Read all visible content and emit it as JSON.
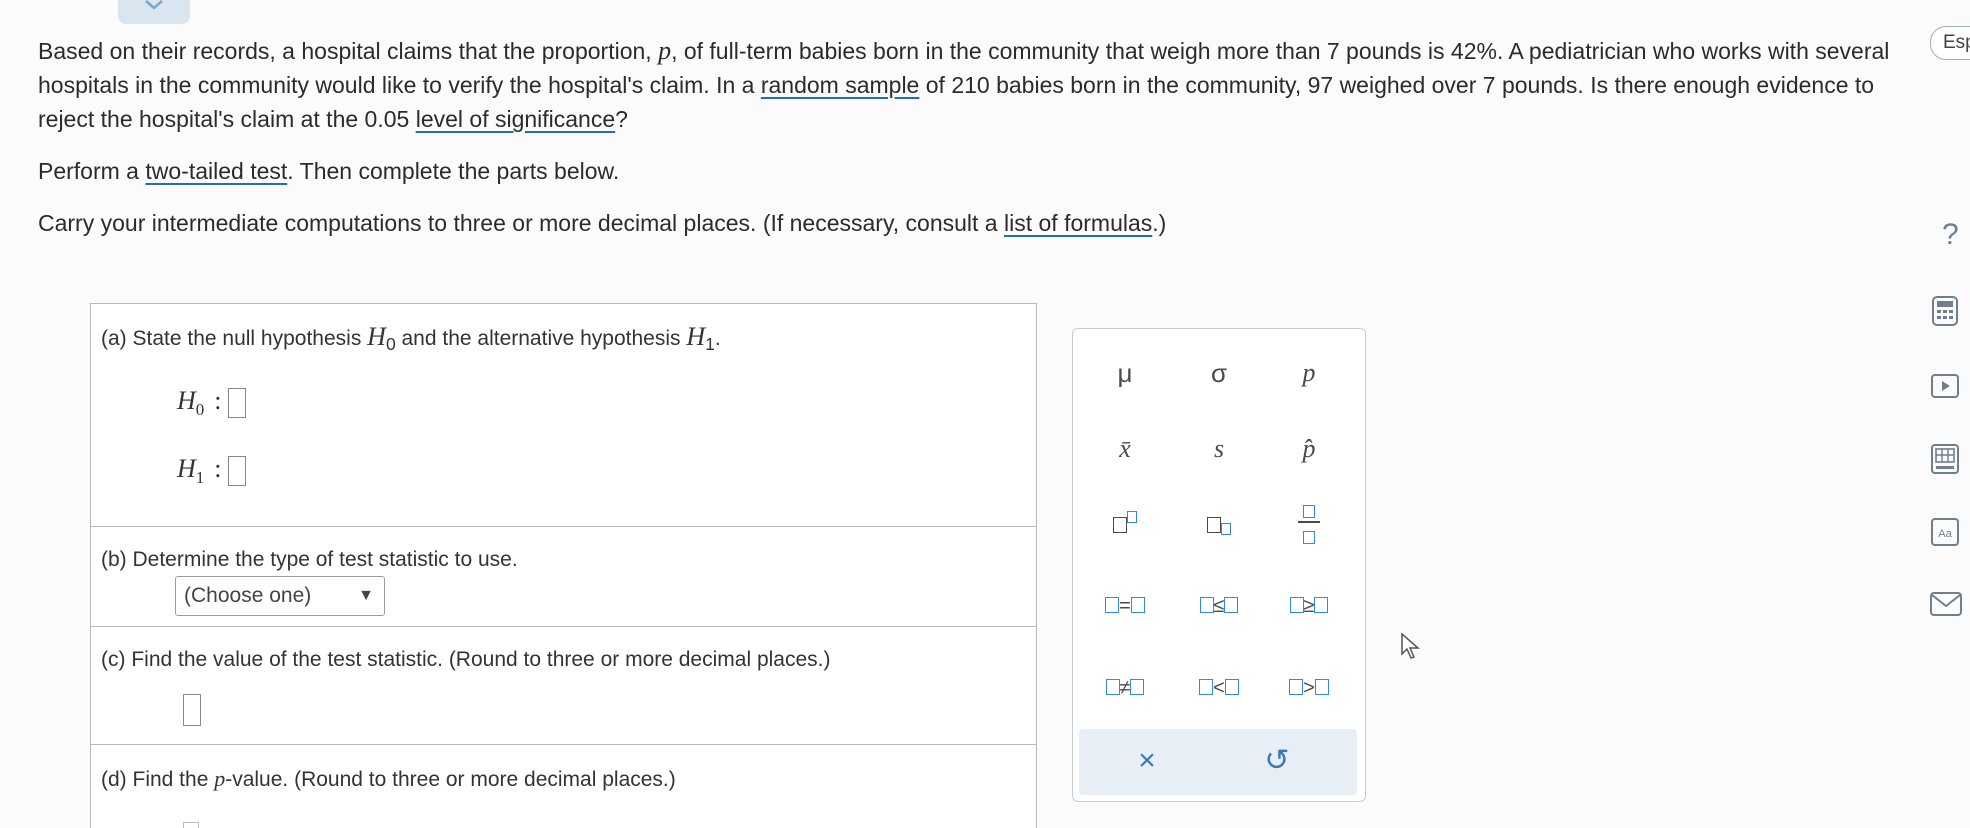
{
  "problem": {
    "p1_a": "Based on their records, a hospital claims that the proportion, ",
    "p1_var": "p",
    "p1_b": ", of full-term babies born in the community that weigh more than 7 pounds is 42%. A pediatrician who works with several hospitals in the community would like to verify the hospital's claim. In a ",
    "p1_link1": "random sample",
    "p1_c": " of 210 babies born in the community, 97 weighed over 7 pounds. Is there enough evidence to reject the hospital's claim at the 0.05 ",
    "p1_link2": "level of significance",
    "p1_d": "?",
    "p2_a": "Perform a ",
    "p2_link": "two-tailed test",
    "p2_b": ". Then complete the parts below.",
    "p3_a": "Carry your intermediate computations to three or more decimal places. (If necessary, consult a ",
    "p3_link": "list of formulas",
    "p3_b": ".)"
  },
  "parts": {
    "a": {
      "label_a": "(a)  State the null hypothesis ",
      "h0": "H",
      "h0_sub": "0",
      "label_b": " and the alternative hypothesis ",
      "h1": "H",
      "h1_sub": "1",
      "label_c": "."
    },
    "b": {
      "label": "(b)  Determine the type of test statistic to use.",
      "select_value": "(Choose one)",
      "select_arrow": "▼"
    },
    "c": {
      "label": "(c)  Find the value of the test statistic. (Round to three or more decimal places.)"
    },
    "d": {
      "label_a": "(d)  Find the ",
      "label_var": "p",
      "label_b": "-value. (Round to three or more decimal places.)"
    }
  },
  "palette": {
    "row1": [
      "μ",
      "σ",
      "p"
    ],
    "row2": [
      "x̄",
      "s",
      "p̂"
    ],
    "row4": [
      "=",
      "≤",
      "≥"
    ],
    "row5": [
      "≠",
      "<",
      ">"
    ],
    "clear": "×",
    "undo": "↺"
  },
  "sidebar": {
    "language": "Esp",
    "help": "?"
  },
  "colors": {
    "accent": "#2f8ce0",
    "link_underline": "#1f6fb2",
    "palette_footer": "#e7eef5"
  }
}
